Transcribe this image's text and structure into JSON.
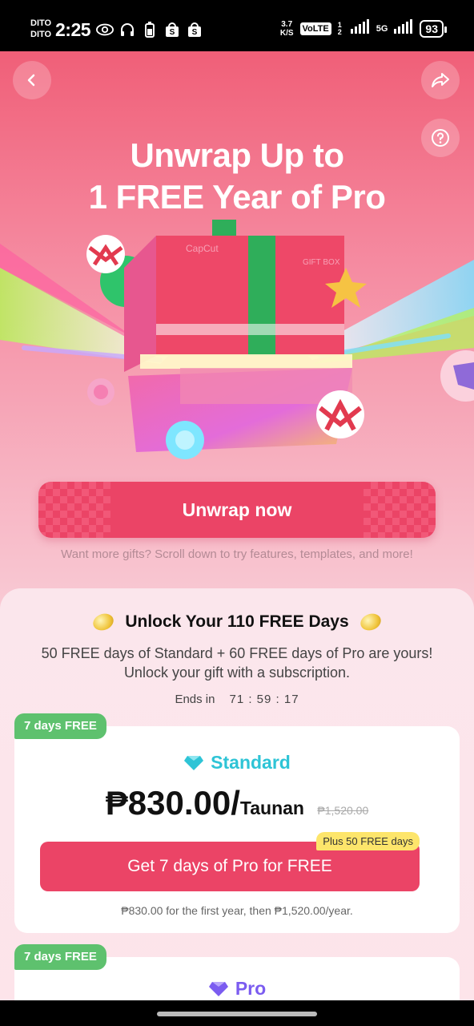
{
  "status_bar": {
    "carrier_1": "DITO",
    "carrier_2": "DITO",
    "time": "2:25",
    "net_speed_value": "3.7",
    "net_speed_unit": "K/S",
    "volte": "VoLTE",
    "sim": "1 2",
    "network": "5G",
    "battery": "93",
    "left_icons": [
      "eye-icon",
      "headphones-icon",
      "battery-saver-icon",
      "shopee-icon",
      "shopee-icon"
    ]
  },
  "header": {
    "back_icon": "chevron-left-icon",
    "share_icon": "share-icon",
    "help_icon": "question-icon"
  },
  "hero": {
    "title_line1": "Unwrap Up to",
    "title_line2": "1 FREE Year of Pro",
    "box_brand": "CapCut",
    "box_label": "GIFT BOX"
  },
  "unwrap": {
    "button_label": "Unwrap now",
    "hint": "Want more gifts? Scroll down to try features, templates, and more!"
  },
  "offer": {
    "title": "Unlock Your 110 FREE Days",
    "subtitle": "50 FREE days of Standard + 60 FREE days of Pro are yours! Unlock your gift with a subscription.",
    "ends_label": "Ends in",
    "timer": "71 : 59 : 17"
  },
  "plans": [
    {
      "tag": "7 days FREE",
      "name": "Standard",
      "price": "₱830.00/",
      "period": "Taunan",
      "old_price": "₱1,520.00",
      "cta": "Get 7 days of Pro for FREE",
      "bonus": "Plus 50 FREE days",
      "fine_print": "₱830.00 for the first year, then ₱1,520.00/year."
    },
    {
      "tag": "7 days FREE",
      "name": "Pro"
    }
  ],
  "colors": {
    "accent": "#eb4466",
    "standard": "#2ec4d6",
    "pro": "#7b5cf0",
    "tag": "#5ec16e",
    "bonus": "#fde56b"
  }
}
